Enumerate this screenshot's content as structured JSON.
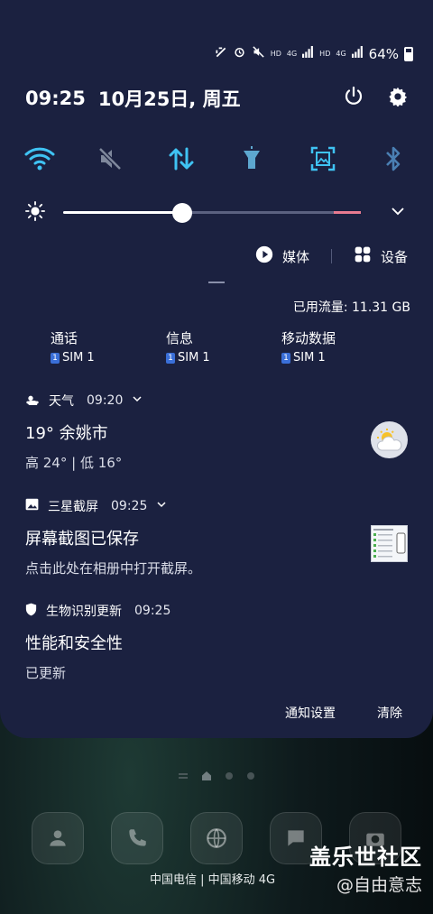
{
  "status_bar": {
    "battery": "64%",
    "hd_1": "HD",
    "net_1": "4G",
    "hd_2": "HD",
    "net_2": "4G"
  },
  "header": {
    "time": "09:25",
    "date": "10月25日, 周五"
  },
  "quick_settings": {
    "tiles": [
      "wifi-icon",
      "sound-muted-icon",
      "mobile-data-icon",
      "flashlight-icon",
      "screenshot-icon",
      "bluetooth-icon"
    ],
    "active_color": "#3fc3f3"
  },
  "brightness": {
    "level_fraction": 0.4
  },
  "media_row": {
    "media_label": "媒体",
    "devices_label": "设备"
  },
  "data_usage": "已用流量: 11.31 GB",
  "sim_settings": [
    {
      "title": "通话",
      "sim": "SIM 1",
      "badge": "1"
    },
    {
      "title": "信息",
      "sim": "SIM 1",
      "badge": "1"
    },
    {
      "title": "移动数据",
      "sim": "SIM 1",
      "badge": "1"
    }
  ],
  "notifications": {
    "weather": {
      "app": "天气",
      "time": "09:20",
      "title": "19° 余姚市",
      "body": "高 24° | 低 16°"
    },
    "screenshot": {
      "app": "三星截屏",
      "time": "09:25",
      "title": "屏幕截图已保存",
      "body": "点击此处在相册中打开截屏。"
    },
    "biometrics": {
      "app": "生物识别更新",
      "time": "09:25",
      "title": "性能和安全性",
      "body": "已更新"
    }
  },
  "actions": {
    "settings": "通知设置",
    "clear": "清除"
  },
  "home": {
    "carrier": "中国电信 | 中国移动 4G"
  },
  "watermark": {
    "title": "盖乐世社区",
    "subtitle": "@自由意志"
  }
}
